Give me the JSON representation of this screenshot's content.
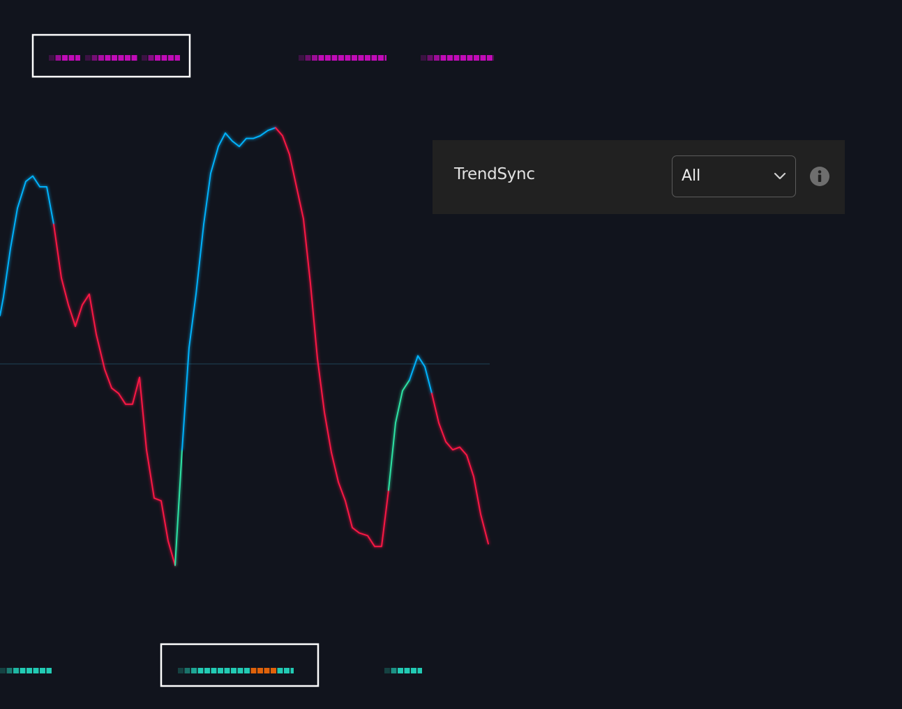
{
  "chart_data": {
    "type": "line",
    "ylim": [
      -100,
      100
    ],
    "zero_line": 0,
    "series": [
      {
        "color": "#00b4ff",
        "segment": "bullish",
        "x": [
          0,
          5,
          15,
          25,
          37,
          47,
          57,
          67,
          77
        ],
        "y": [
          18,
          25,
          43,
          58,
          68,
          70,
          66,
          66,
          52
        ]
      },
      {
        "color": "#ff1744",
        "segment": "bearish",
        "x": [
          77,
          88,
          98,
          108,
          118,
          128,
          138,
          150,
          160,
          170,
          180,
          190,
          200,
          210,
          221,
          231,
          241,
          251
        ],
        "y": [
          52,
          32,
          22,
          14,
          22,
          26,
          11,
          -2,
          -9,
          -11,
          -15,
          -15,
          -5,
          -32,
          -50,
          -51,
          -66,
          -75
        ]
      },
      {
        "color": "#2ee6a6",
        "segment": "reversal-up",
        "x": [
          251,
          261
        ],
        "y": [
          -75,
          -32
        ]
      },
      {
        "color": "#00b4ff",
        "segment": "bullish",
        "x": [
          261,
          271,
          281,
          292,
          302,
          313,
          323,
          333,
          343,
          353,
          363,
          373,
          384,
          395
        ],
        "y": [
          -32,
          6,
          26,
          52,
          71,
          81,
          86,
          83,
          81,
          84,
          84,
          85,
          87,
          88
        ]
      },
      {
        "color": "#ff1744",
        "segment": "bearish",
        "x": [
          395,
          405,
          415,
          425,
          435,
          445,
          455,
          465,
          475,
          485,
          495,
          505,
          515,
          527,
          537,
          547,
          557
        ],
        "y": [
          88,
          85,
          78,
          66,
          54,
          30,
          2,
          -18,
          -33,
          -44,
          -51,
          -61,
          -63,
          -64,
          -68,
          -68,
          -47
        ]
      },
      {
        "color": "#2ee6a6",
        "segment": "reversal-up",
        "x": [
          557,
          567,
          577,
          587
        ],
        "y": [
          -47,
          -22,
          -10,
          -6
        ]
      },
      {
        "color": "#00b4ff",
        "segment": "bullish",
        "x": [
          587,
          599,
          609,
          619
        ],
        "y": [
          -6,
          3,
          -1,
          -11
        ]
      },
      {
        "color": "#ff1744",
        "segment": "bearish",
        "x": [
          619,
          629,
          639,
          649,
          659,
          669,
          679,
          689,
          700
        ],
        "y": [
          -11,
          -22,
          -29,
          -32,
          -31,
          -34,
          -42,
          -56,
          -67
        ]
      }
    ],
    "top_markers": {
      "color": "#c10bb7",
      "bands": [
        [
          70,
          115
        ],
        [
          122,
          197
        ],
        [
          203,
          258
        ],
        [
          428,
          554
        ],
        [
          603,
          708
        ]
      ]
    },
    "bottom_markers": {
      "color": "#22cbb4",
      "accent_color": "#e0620a",
      "bands": [
        [
          0,
          74
        ],
        [
          255,
          421
        ],
        [
          551,
          605
        ]
      ],
      "accent": [
        [
          357,
          400
        ]
      ]
    },
    "highlight_boxes": [
      {
        "from": 46,
        "to": 273,
        "row": "top"
      },
      {
        "from": 230,
        "to": 457,
        "row": "bottom"
      }
    ]
  },
  "panel": {
    "label": "TrendSync",
    "select": {
      "value": "All",
      "icon": "chevron-down-icon"
    },
    "info_icon": "info-icon"
  },
  "colors": {
    "background": "#11141d",
    "panel_bg": "#212121",
    "zero_line": "#1f4458",
    "highlight_border": "#ffffff"
  }
}
